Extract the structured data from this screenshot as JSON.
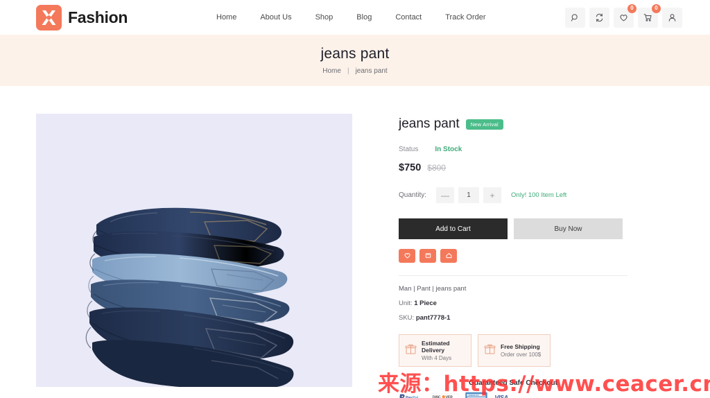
{
  "header": {
    "brand_name": "Fashion",
    "logo_color": "#f4795b",
    "nav": [
      {
        "label": "Home"
      },
      {
        "label": "About Us"
      },
      {
        "label": "Shop"
      },
      {
        "label": "Blog"
      },
      {
        "label": "Contact"
      },
      {
        "label": "Track Order"
      }
    ],
    "actions": [
      {
        "icon": "search-icon",
        "badge": null
      },
      {
        "icon": "compare-icon",
        "badge": null
      },
      {
        "icon": "heart-icon",
        "badge": "0"
      },
      {
        "icon": "cart-icon",
        "badge": "0"
      },
      {
        "icon": "user-icon",
        "badge": null
      }
    ]
  },
  "banner": {
    "title": "jeans pant",
    "crumb_home": "Home",
    "crumb_sep": "|",
    "crumb_current": "jeans pant",
    "bg_color": "#fdf2ea"
  },
  "product": {
    "title": "jeans pant",
    "badge": "New Arrival",
    "badge_color": "#4bbd8a",
    "status_label": "Status",
    "status_value": "In Stock",
    "price_now": "$750",
    "price_old": "$800",
    "quantity_label": "Quantity:",
    "quantity_value": "1",
    "minus": "—",
    "plus": "+",
    "stock_note": "Only! 100 Item Left",
    "add_to_cart": "Add to Cart",
    "buy_now": "Buy Now",
    "mini_actions": [
      {
        "icon": "wishlist-heart-icon"
      },
      {
        "icon": "compare-icon"
      },
      {
        "icon": "share-icon"
      }
    ],
    "category_path": "Man | Pant | jeans pant",
    "unit_label": "Unit:",
    "unit_value": "1 Piece",
    "sku_label": "SKU:",
    "sku_value": "pant7778-1",
    "image_bg": "#e9e9f7",
    "image_alt": "stack-of-folded-jeans"
  },
  "promos": [
    {
      "icon": "gift-icon",
      "title": "Estimated Delivery",
      "sub": "With 4 Days"
    },
    {
      "icon": "gift-icon",
      "title": "Free Shipping",
      "sub": "Order over 100$"
    }
  ],
  "checkout": {
    "title": "Guaranteed Safe Checkout",
    "payments": [
      {
        "name": "PayPal"
      },
      {
        "name": "DISCOVER"
      },
      {
        "name": "AMERICAN EXPRESS"
      },
      {
        "name": "VISA"
      }
    ]
  },
  "watermark": {
    "text": "来源：https://www.ceacer.cn",
    "color": "#ff2a2a"
  }
}
